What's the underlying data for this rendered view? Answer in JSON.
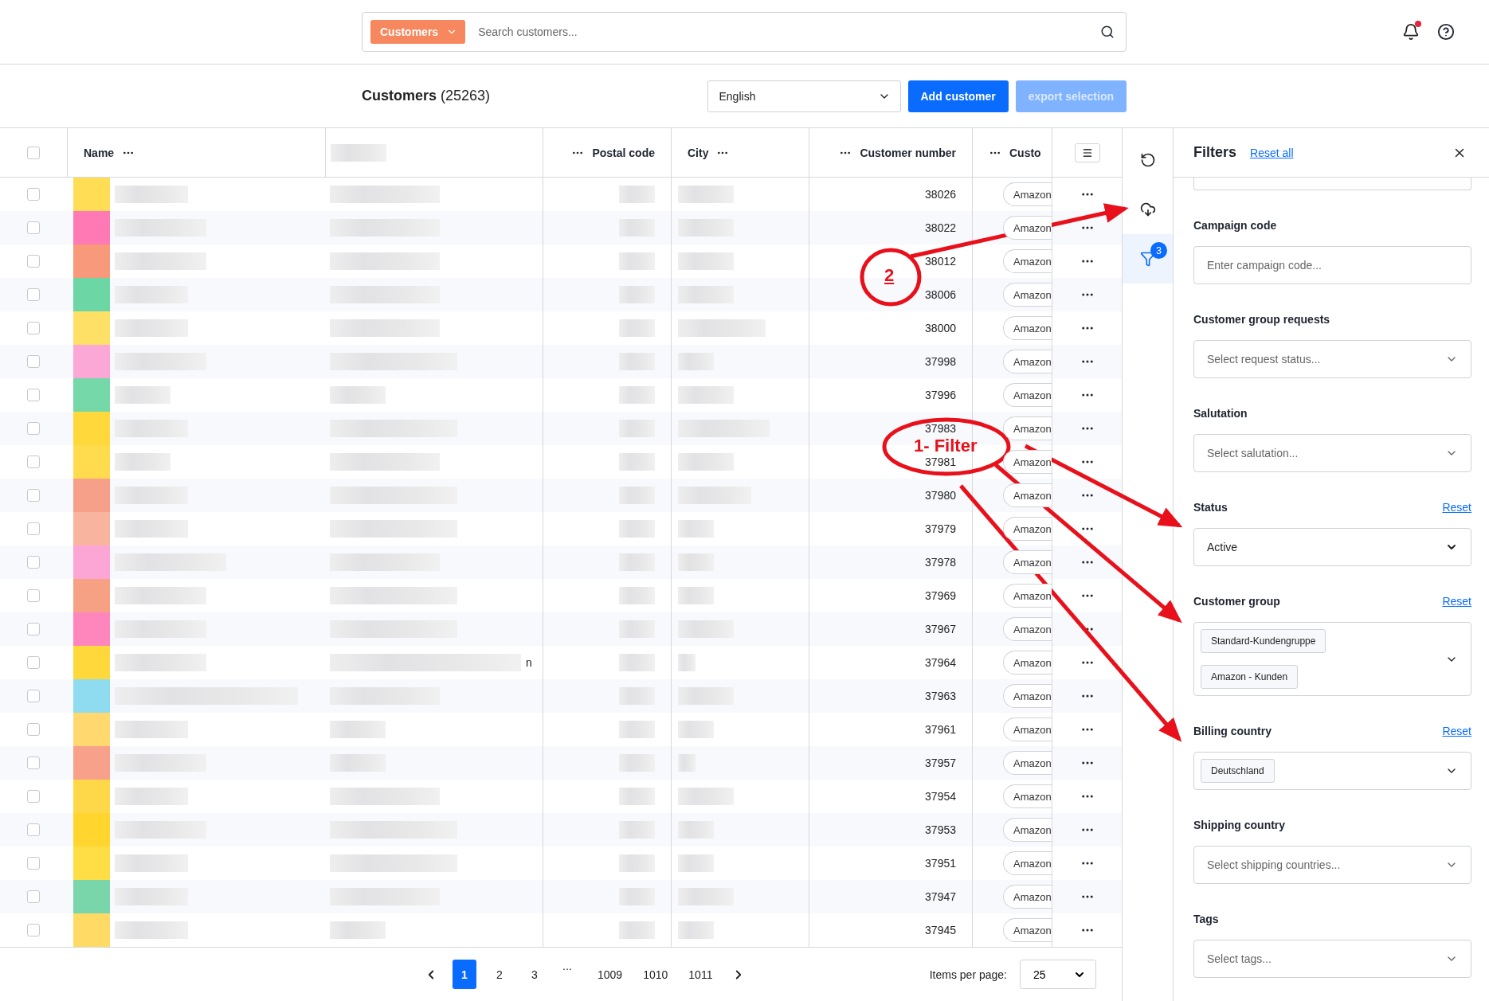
{
  "top_bar": {
    "scope": "Customers",
    "search": {
      "placeholder": "Search customers..."
    },
    "notifications": {
      "unread": true
    }
  },
  "header": {
    "title": "Customers",
    "count": "(25263)",
    "language": "English",
    "add_button": "Add customer",
    "export_button": {
      "label": "export selection",
      "disabled": true
    }
  },
  "table": {
    "select_all": {
      "checked": false
    },
    "columns": [
      {
        "kind": "name",
        "label": "Name"
      },
      {
        "kind": "redacted"
      },
      {
        "kind": "postal",
        "label": "Postal code"
      },
      {
        "kind": "city",
        "label": "City"
      },
      {
        "kind": "number",
        "label": "Customer number"
      },
      {
        "kind": "chip",
        "label": "Custo"
      }
    ],
    "rows": [
      {
        "checked": false,
        "color": "#ffdd55",
        "customer_number": "38026",
        "column_7": "Amazon"
      },
      {
        "checked": false,
        "color": "#ff7ab5",
        "customer_number": "38022",
        "column_7": "Amazon"
      },
      {
        "checked": false,
        "color": "#f7997a",
        "customer_number": "38012",
        "column_7": "Amazon"
      },
      {
        "checked": false,
        "color": "#6cd6a5",
        "customer_number": "38006",
        "column_7": "Amazon"
      },
      {
        "checked": false,
        "color": "#ffe066",
        "customer_number": "38000",
        "column_7": "Amazon"
      },
      {
        "checked": false,
        "color": "#fca8d6",
        "customer_number": "37998",
        "column_7": "Amazon"
      },
      {
        "checked": false,
        "color": "#74d8a8",
        "customer_number": "37996",
        "column_7": "Amazon"
      },
      {
        "checked": false,
        "color": "#ffd93b",
        "customer_number": "37983",
        "column_7": "Amazon"
      },
      {
        "checked": false,
        "color": "#ffdb4d",
        "customer_number": "37981",
        "column_7": "Amazon"
      },
      {
        "checked": false,
        "color": "#f6a08a",
        "customer_number": "37980",
        "column_7": "Amazon"
      },
      {
        "checked": false,
        "color": "#f9b49f",
        "customer_number": "37979",
        "column_7": "Amazon"
      },
      {
        "checked": false,
        "color": "#fba6d4",
        "customer_number": "37978",
        "column_7": "Amazon"
      },
      {
        "checked": false,
        "color": "#f6a084",
        "customer_number": "37969",
        "column_7": "Amazon"
      },
      {
        "checked": false,
        "color": "#ff85bd",
        "customer_number": "37967",
        "column_7": "Amazon"
      },
      {
        "checked": false,
        "color": "#ffd93b",
        "customer_number": "37964",
        "column_7": "Amazon",
        "column_3_tail": "n"
      },
      {
        "checked": false,
        "color": "#8fdcf0",
        "customer_number": "37963",
        "column_7": "Amazon"
      },
      {
        "checked": false,
        "color": "#ffd970",
        "customer_number": "37961",
        "column_7": "Amazon"
      },
      {
        "checked": false,
        "color": "#f7a08a",
        "customer_number": "37957",
        "column_7": "Amazon"
      },
      {
        "checked": false,
        "color": "#ffd84a",
        "customer_number": "37954",
        "column_7": "Amazon"
      },
      {
        "checked": false,
        "color": "#ffd52e",
        "customer_number": "37953",
        "column_7": "Amazon"
      },
      {
        "checked": false,
        "color": "#ffdd44",
        "customer_number": "37951",
        "column_7": "Amazon"
      },
      {
        "checked": false,
        "color": "#79d6ab",
        "customer_number": "37947",
        "column_7": "Amazon"
      },
      {
        "checked": false,
        "color": "#ffdb66",
        "customer_number": "37945",
        "column_7": "Amazon"
      }
    ]
  },
  "pagination": {
    "pages": [
      {
        "kind": "page",
        "label": "1",
        "selected": true
      },
      {
        "kind": "page",
        "label": "2",
        "selected": false
      },
      {
        "kind": "page",
        "label": "3",
        "selected": false
      },
      {
        "kind": "ellipsis",
        "label": "..."
      },
      {
        "kind": "page",
        "label": "1009",
        "selected": false
      },
      {
        "kind": "page",
        "label": "1010",
        "selected": false
      },
      {
        "kind": "page",
        "label": "1011",
        "selected": false
      }
    ],
    "items_per_page_label": "Items per page:",
    "items_per_page": "25"
  },
  "side_tools": [
    {
      "kind": "reset",
      "selected": false
    },
    {
      "kind": "download",
      "selected": false
    },
    {
      "kind": "filter",
      "selected": true,
      "badge": "3"
    }
  ],
  "filters": {
    "title": "Filters",
    "reset_all": "Reset all",
    "fields": [
      {
        "kind": "input",
        "label": "Campaign code",
        "placeholder": "Enter campaign code..."
      },
      {
        "kind": "select",
        "label": "Customer group requests",
        "placeholder": "Select request status..."
      },
      {
        "kind": "select",
        "label": "Salutation",
        "placeholder": "Select salutation..."
      },
      {
        "kind": "select",
        "label": "Status",
        "value": "Active",
        "reset": "Reset"
      },
      {
        "kind": "multiselect",
        "label": "Customer group",
        "chips": [
          "Standard-Kundengruppe",
          "Amazon - Kunden"
        ],
        "reset": "Reset"
      },
      {
        "kind": "multiselect",
        "label": "Billing country",
        "chips": [
          "Deutschland"
        ],
        "reset": "Reset"
      },
      {
        "kind": "select",
        "label": "Shipping country",
        "placeholder": "Select shipping countries..."
      },
      {
        "kind": "select",
        "label": "Tags",
        "placeholder": "Select tags..."
      }
    ]
  },
  "annotations": [
    {
      "kind": "circle_label",
      "text": "2"
    },
    {
      "kind": "circle_label",
      "text": "1- Filter"
    }
  ]
}
